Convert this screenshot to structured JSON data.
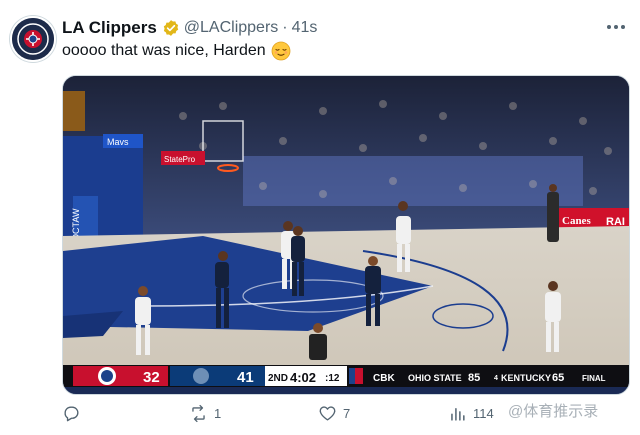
{
  "tweet": {
    "author_name": "LA Clippers",
    "handle": "@LAClippers",
    "separator": "·",
    "time": "41s",
    "text": "ooooo that was nice, Harden",
    "more_icon": "more-horizontal-icon",
    "verified_color": "#e2b719"
  },
  "scoreboard": {
    "away_score": "32",
    "home_score": "41",
    "quarter": "2ND",
    "clock": "4:02",
    "shot_clock": ":12",
    "ticker_label": "CBK",
    "ticker_team1": "OHIO STATE",
    "ticker_score1": "85",
    "ticker_team2_rank": "4",
    "ticker_team2": "KENTUCKY",
    "ticker_score2": "65",
    "ticker_status": "FINAL",
    "away_color": "#c8102e",
    "home_color": "#0b3b78"
  },
  "arena_text": {
    "sign_left": "Mavs",
    "sign_stat": "StatePro",
    "sign_right": "RAI",
    "sign_right_logo": "Canes",
    "court_logo": "CHOCTAW"
  },
  "actions": {
    "reply_count": "",
    "retweet_count": "1",
    "like_count": "7",
    "views_count": "114"
  },
  "watermark": "@体育推示录"
}
